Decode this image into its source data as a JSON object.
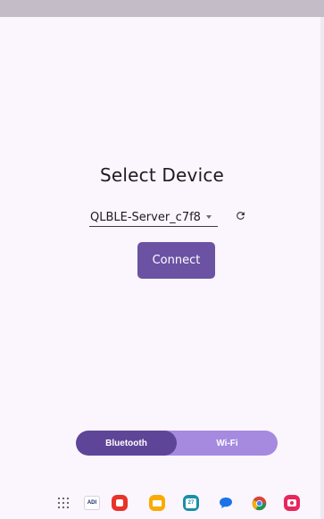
{
  "screen": {
    "title": "Select Device"
  },
  "device_selector": {
    "selected": "QLBLE-Server_c7f8",
    "refresh_icon": "refresh-icon"
  },
  "actions": {
    "connect_label": "Connect"
  },
  "connection_toggle": {
    "options": [
      {
        "label": "Bluetooth",
        "active": true
      },
      {
        "label": "Wi-Fi",
        "active": false
      }
    ]
  },
  "taskbar": {
    "icons": [
      "app-launcher-icon",
      "adi-app-icon",
      "red-app-icon",
      "files-icon",
      "calendar-icon",
      "messages-icon",
      "chrome-icon",
      "camera-icon"
    ],
    "calendar_day": "27",
    "adi_text": "ADI"
  },
  "colors": {
    "accent": "#6b52a3",
    "toggle_active": "#5f4598",
    "toggle_track": "#a58ae0",
    "background": "#fbf5fd"
  }
}
